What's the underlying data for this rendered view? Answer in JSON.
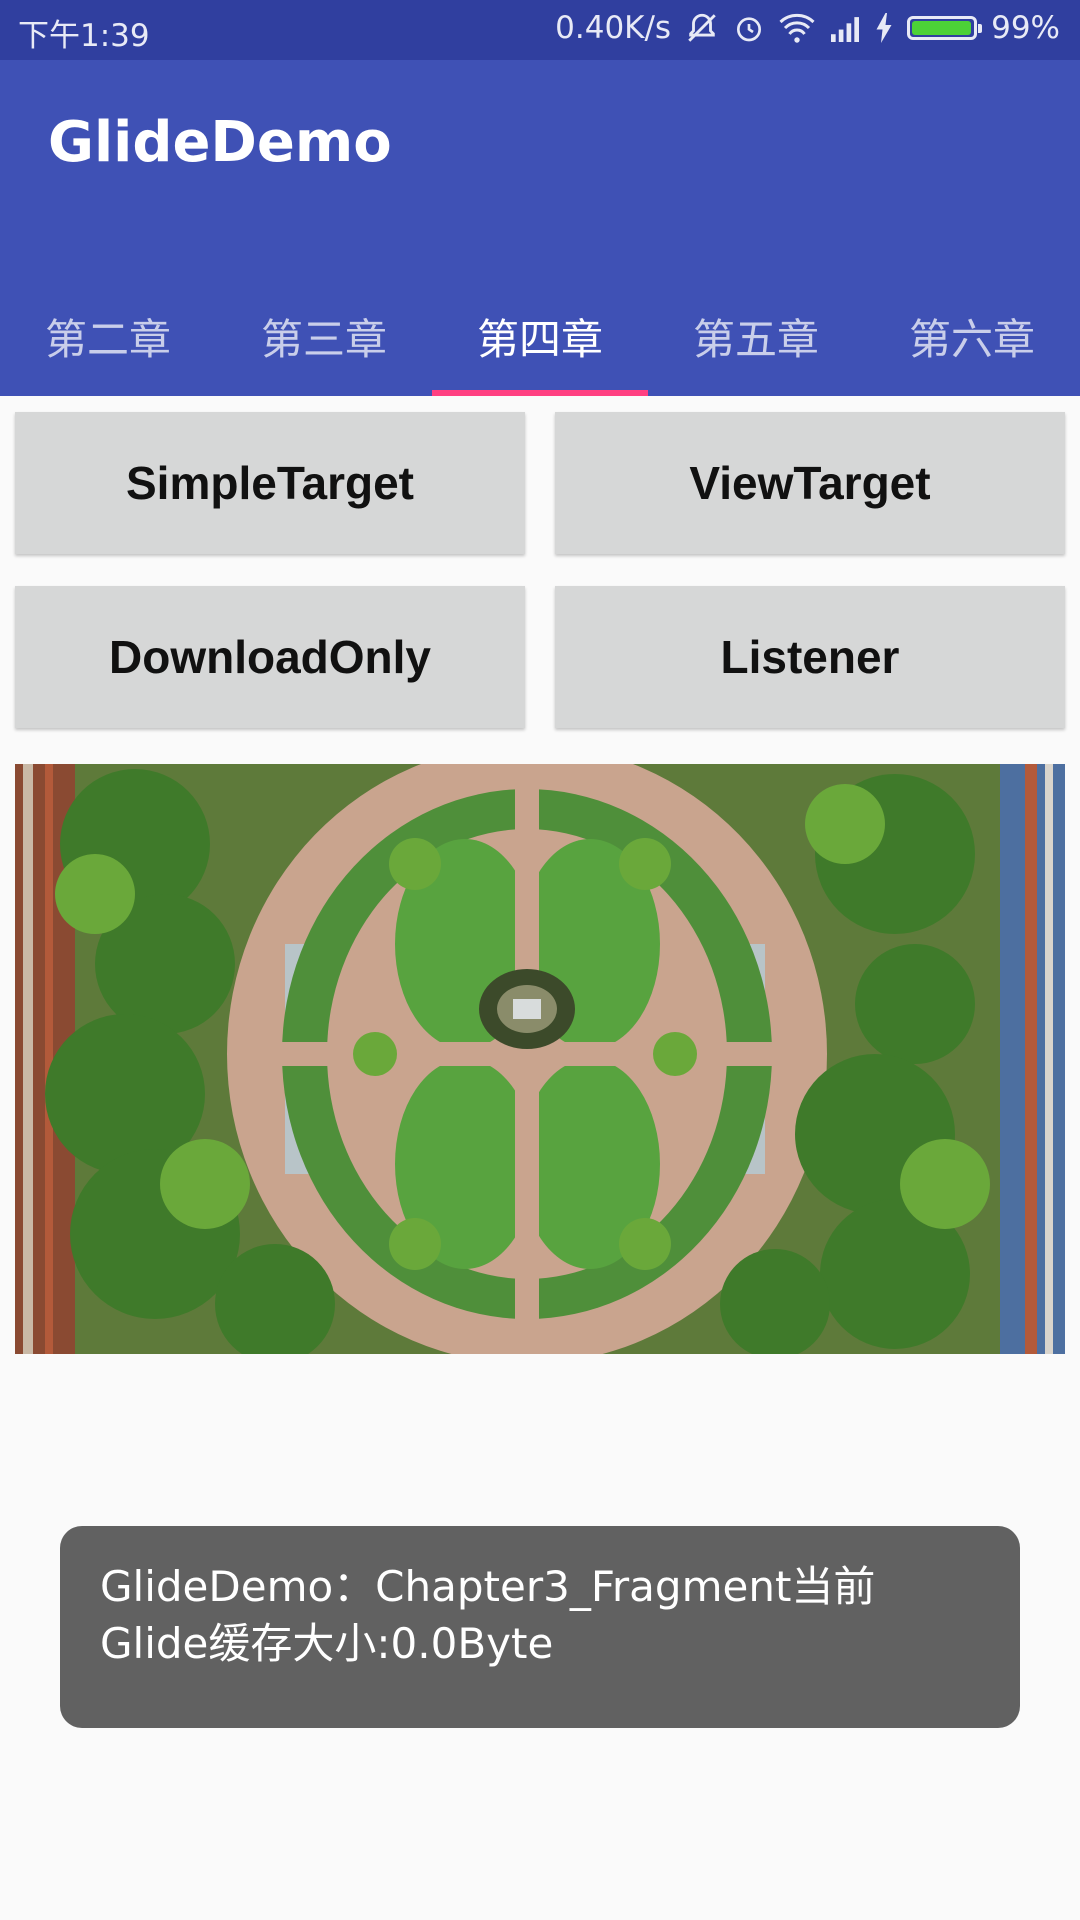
{
  "status_bar": {
    "time": "下午1:39",
    "net_speed": "0.40K/s",
    "battery_text": "99%",
    "battery_level": 0.99,
    "battery_color": "#4cd137"
  },
  "app_bar": {
    "title": "GlideDemo",
    "color": "#3f51b5"
  },
  "tabs": [
    {
      "label": "第二章",
      "active": false
    },
    {
      "label": "第三章",
      "active": false
    },
    {
      "label": "第四章",
      "active": true
    },
    {
      "label": "第五章",
      "active": false
    },
    {
      "label": "第六章",
      "active": false
    }
  ],
  "accent_color": "#ff4081",
  "buttons": {
    "simple_target": "SimpleTarget",
    "view_target": "ViewTarget",
    "download_only": "DownloadOnly",
    "listener": "Listener"
  },
  "toast": {
    "line1": "GlideDemo：Chapter3_Fragment当前",
    "line2": "Glide缓存大小:0.0Byte"
  }
}
